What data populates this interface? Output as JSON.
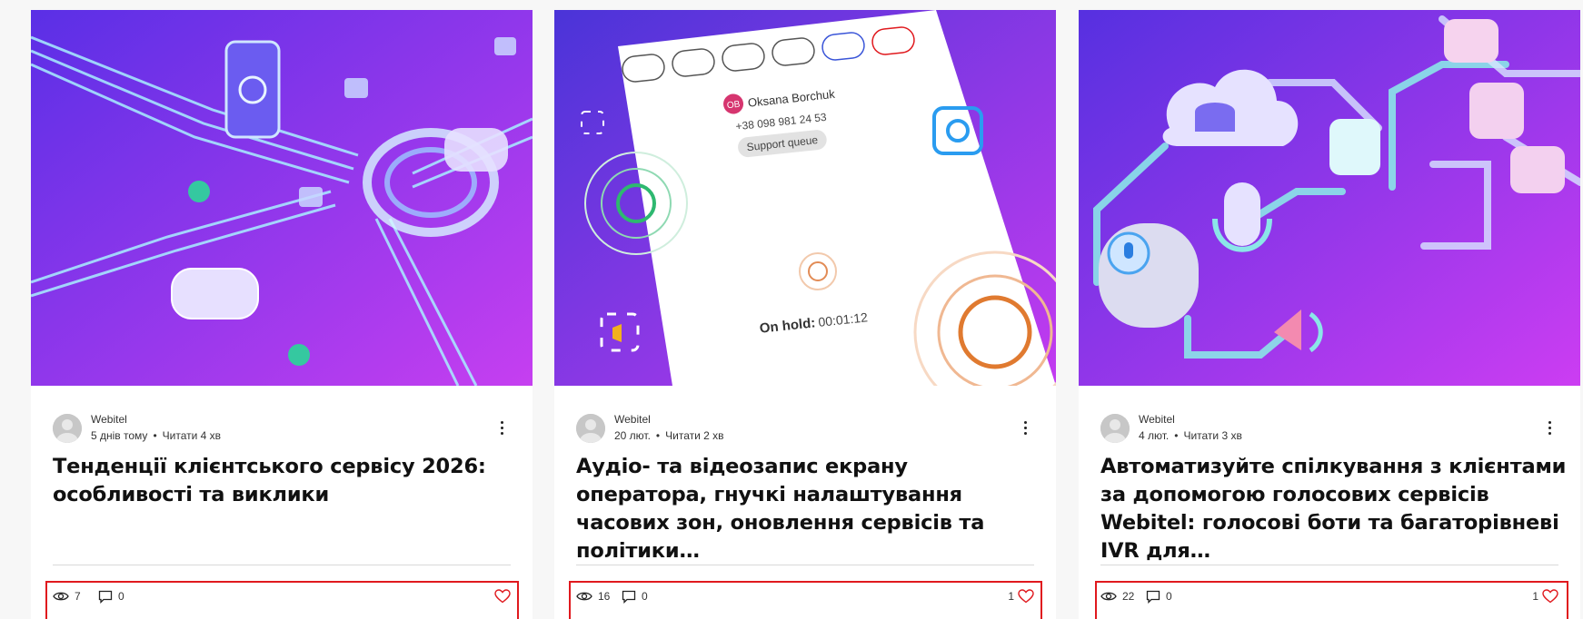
{
  "colors": {
    "accent": "#e0191e",
    "like_heart": "#e0191e",
    "cover_gradient_start": "#5b2ee0",
    "cover_gradient_end": "#c93cf2"
  },
  "posts": [
    {
      "author": "Webitel",
      "date": "5 днів тому",
      "read_time": "Читати 4 хв",
      "title": "Тенденції клієнтського сервісу 2026: особливості та виклики",
      "views": "7",
      "comments": "0",
      "likes": "",
      "cover_icon": "cyber-security-illustration"
    },
    {
      "author": "Webitel",
      "date": "20 лют.",
      "read_time": "Читати 2 хв",
      "title": "Аудіо- та відеозапис екрану оператора, гнучкі налаштування часових зон, оновлення сервісів та політики…",
      "views": "16",
      "comments": "0",
      "likes": "1",
      "cover_icon": "call-screen-illustration",
      "cover_text": {
        "initials": "OB",
        "caller_name": "Oksana Borchuk",
        "caller_phone": "+38 098 981 24 53",
        "queue": "Support queue",
        "hold_label": "On hold:",
        "hold_time": "00:01:12"
      }
    },
    {
      "author": "Webitel",
      "date": "4 лют.",
      "read_time": "Читати 3 хв",
      "title": "Автоматизуйте спілкування з клієнтами за допомогою голосових сервісів Webitel: голосові боти та багаторівневі IVR для…",
      "views": "22",
      "comments": "0",
      "likes": "1",
      "cover_icon": "voice-services-illustration"
    }
  ]
}
